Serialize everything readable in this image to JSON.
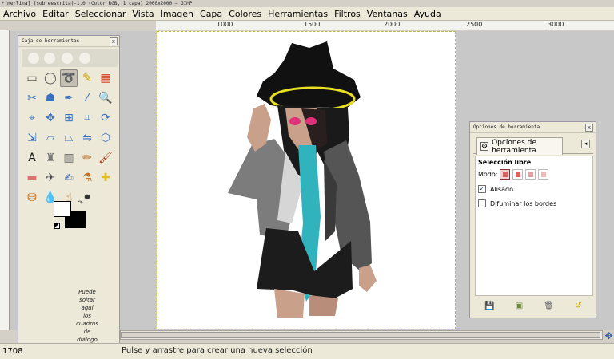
{
  "window": {
    "title": "*[merlina] (sobreescrita)-1.0 (Color RGB, 1 capa) 2000x2000 – GIMP"
  },
  "menu": [
    {
      "label": "Archivo"
    },
    {
      "label": "Editar"
    },
    {
      "label": "Seleccionar"
    },
    {
      "label": "Vista"
    },
    {
      "label": "Imagen"
    },
    {
      "label": "Capa"
    },
    {
      "label": "Colores"
    },
    {
      "label": "Herramientas"
    },
    {
      "label": "Filtros"
    },
    {
      "label": "Ventanas"
    },
    {
      "label": "Ayuda"
    }
  ],
  "ruler": {
    "labels": [
      "1000",
      "1500",
      "2000",
      "2500",
      "3000"
    ]
  },
  "toolbox": {
    "title": "Caja de herramientas",
    "tools": [
      {
        "icon": "rect-select-icon",
        "glyph": "▭",
        "color": "#555"
      },
      {
        "icon": "ellipse-select-icon",
        "glyph": "◯",
        "color": "#555"
      },
      {
        "icon": "free-select-icon",
        "glyph": "➰",
        "color": "#444",
        "active": true
      },
      {
        "icon": "fuzzy-select-icon",
        "glyph": "✎",
        "color": "#c8a000"
      },
      {
        "icon": "by-color-select-icon",
        "glyph": "▦",
        "color": "#d04020"
      },
      {
        "icon": "scissors-select-icon",
        "glyph": "✂",
        "color": "#3a6fc0"
      },
      {
        "icon": "foreground-select-icon",
        "glyph": "☗",
        "color": "#3a6fc0"
      },
      {
        "icon": "paths-icon",
        "glyph": "✒",
        "color": "#3a6fc0"
      },
      {
        "icon": "color-picker-icon",
        "glyph": "⁄",
        "color": "#3a6fc0"
      },
      {
        "icon": "zoom-icon",
        "glyph": "🔍",
        "color": "#3a6fc0"
      },
      {
        "icon": "measure-icon",
        "glyph": "⌖",
        "color": "#3a6fc0"
      },
      {
        "icon": "move-icon",
        "glyph": "✥",
        "color": "#3a6fc0"
      },
      {
        "icon": "align-icon",
        "glyph": "⊞",
        "color": "#3a6fc0"
      },
      {
        "icon": "crop-icon",
        "glyph": "⌗",
        "color": "#3a6fc0"
      },
      {
        "icon": "rotate-icon",
        "glyph": "⟳",
        "color": "#3a6fc0"
      },
      {
        "icon": "scale-icon",
        "glyph": "⇲",
        "color": "#3a6fc0"
      },
      {
        "icon": "shear-icon",
        "glyph": "▱",
        "color": "#3a6fc0"
      },
      {
        "icon": "perspective-icon",
        "glyph": "⏢",
        "color": "#3a6fc0"
      },
      {
        "icon": "flip-icon",
        "glyph": "⇋",
        "color": "#3a6fc0"
      },
      {
        "icon": "cage-transform-icon",
        "glyph": "⬡",
        "color": "#3a6fc0"
      },
      {
        "icon": "text-icon",
        "glyph": "A",
        "color": "#111"
      },
      {
        "icon": "bucket-fill-icon",
        "glyph": "♜",
        "color": "#777"
      },
      {
        "icon": "blend-icon",
        "glyph": "▥",
        "color": "#666"
      },
      {
        "icon": "pencil-icon",
        "glyph": "✏",
        "color": "#c07020"
      },
      {
        "icon": "paintbrush-icon",
        "glyph": "🖌",
        "color": "#b04020"
      },
      {
        "icon": "eraser-icon",
        "glyph": "▬",
        "color": "#e07070"
      },
      {
        "icon": "airbrush-icon",
        "glyph": "✈",
        "color": "#444"
      },
      {
        "icon": "ink-icon",
        "glyph": "✍",
        "color": "#3a6fc0"
      },
      {
        "icon": "clone-icon",
        "glyph": "⚗",
        "color": "#c07020"
      },
      {
        "icon": "heal-icon",
        "glyph": "✚",
        "color": "#e0c020"
      },
      {
        "icon": "perspective-clone-icon",
        "glyph": "⛁",
        "color": "#c07020"
      },
      {
        "icon": "blur-icon",
        "glyph": "💧",
        "color": "#3a6fc0"
      },
      {
        "icon": "smudge-icon",
        "glyph": "☝",
        "color": "#c07020"
      },
      {
        "icon": "dodge-burn-icon",
        "glyph": "⚫",
        "color": "#333"
      }
    ],
    "drop_hint": "Puede\nsoltar\naquí\nlos\ncuadros\nde\ndiálogo\nempotrables"
  },
  "tool_options": {
    "title": "Opciones de herramienta",
    "tab_label": "Opciones de herramienta",
    "tool_name": "Selección libre",
    "mode_label": "Modo:",
    "antialias_label": "Alisado",
    "antialias_checked": true,
    "feather_label": "Difuminar los bordes",
    "feather_checked": false
  },
  "statusbar": {
    "coords": "1708",
    "message": "Pulse y arrastre para crear una nueva selección"
  },
  "colors": {
    "accent": "#3a6fc0",
    "teal_shirt": "#31b3be"
  }
}
